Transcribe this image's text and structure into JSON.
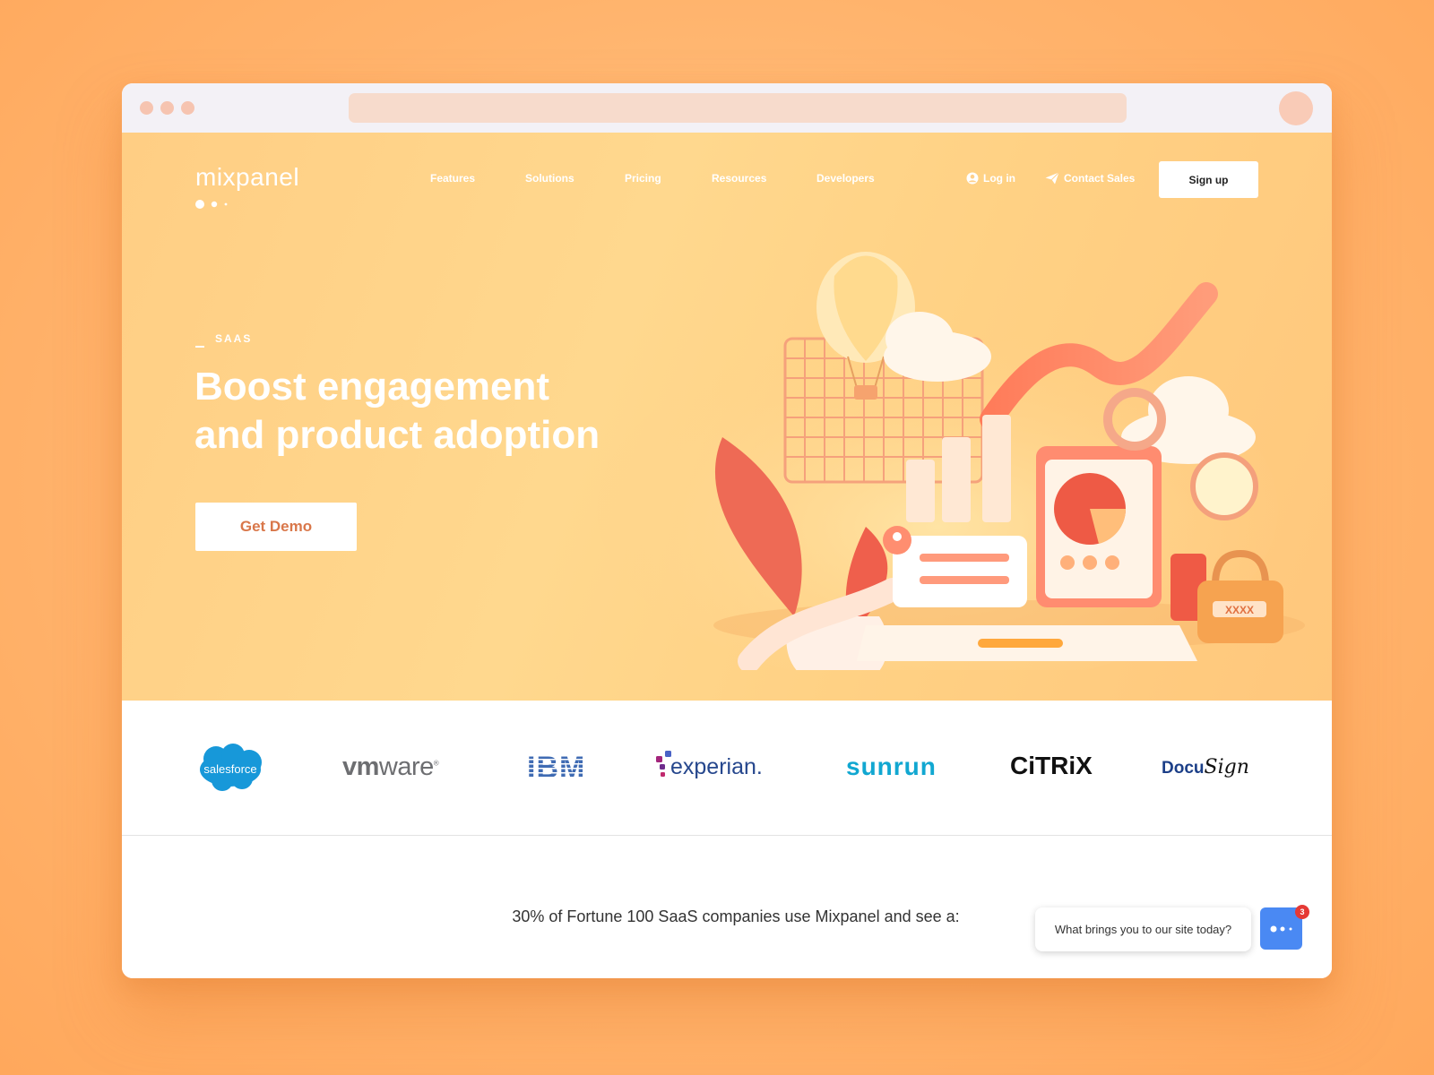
{
  "browser": {
    "dots": [
      "",
      "",
      ""
    ]
  },
  "header": {
    "logo": "mixpanel",
    "nav": [
      "Features",
      "Solutions",
      "Pricing",
      "Resources",
      "Developers"
    ],
    "login": "Log in",
    "contact": "Contact Sales",
    "signup": "Sign up"
  },
  "hero": {
    "eyebrow": "SAAS",
    "headline_line1": "Boost engagement",
    "headline_line2": "and product adoption",
    "cta": "Get Demo",
    "illustration_text": "XXXX"
  },
  "logos": {
    "salesforce": "salesforce",
    "vmware_a": "vm",
    "vmware_b": "ware",
    "ibm": "IBM",
    "experian": "experian.",
    "sunrun": "sunrun",
    "citrix": "CiTRiX",
    "docusign_a": "Docu",
    "docusign_b": "Sign"
  },
  "stats": {
    "text": "30% of Fortune 100 SaaS companies use Mixpanel and see a:"
  },
  "chat": {
    "prompt": "What brings you to our site today?",
    "badge": "3"
  },
  "colors": {
    "accent": "#ffc77c",
    "cta_text": "#d9774a",
    "chat": "#4a89f3",
    "badge": "#e53935"
  }
}
